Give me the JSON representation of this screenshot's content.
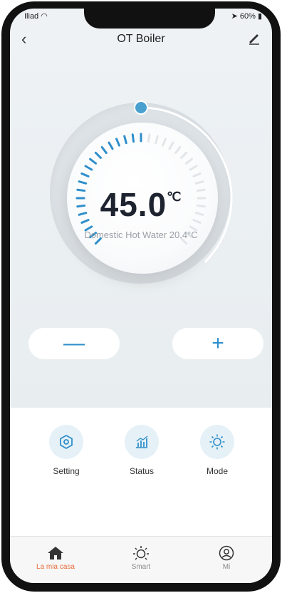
{
  "status": {
    "carrier": "Iliad",
    "battery": "60%"
  },
  "header": {
    "title": "OT Boiler"
  },
  "dial": {
    "temperature": "45.0",
    "unit": "℃",
    "subtitle": "Domestic Hot Water 20.4°C",
    "setpoint_fraction": 0.5
  },
  "controls": {
    "minus": "—",
    "plus": "+"
  },
  "actions": [
    {
      "label": "Setting",
      "icon": "settings-hex-icon"
    },
    {
      "label": "Status",
      "icon": "chart-icon"
    },
    {
      "label": "Mode",
      "icon": "sun-icon"
    }
  ],
  "tabs": [
    {
      "label": "La mia casa",
      "icon": "home-icon",
      "active": true
    },
    {
      "label": "Smart",
      "icon": "sun-icon",
      "active": false
    },
    {
      "label": "Mi",
      "icon": "user-icon",
      "active": false
    }
  ],
  "colors": {
    "accent": "#2f8fcb",
    "active_tab": "#e86b3a"
  }
}
